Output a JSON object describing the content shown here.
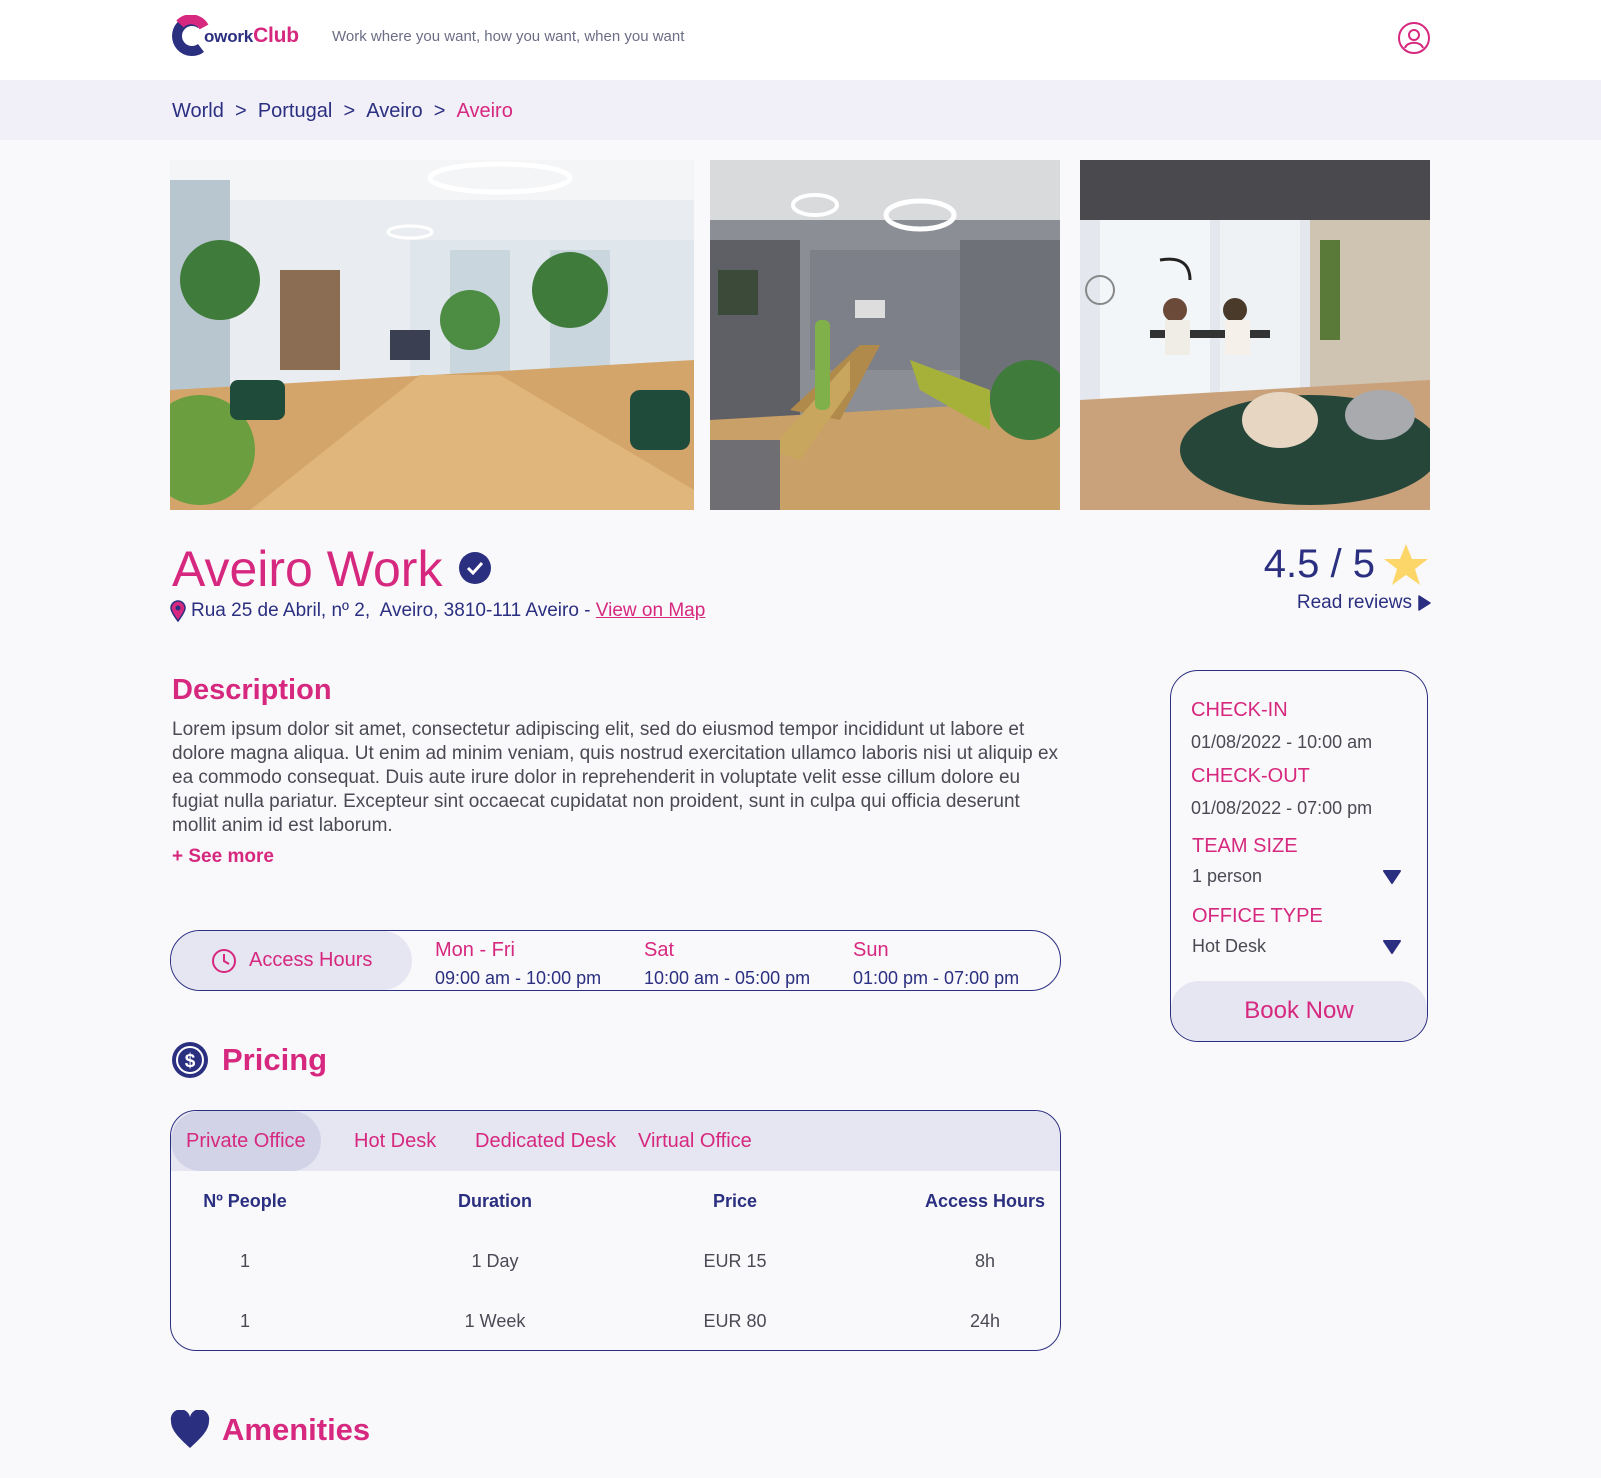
{
  "header": {
    "logo_part1": "owork",
    "logo_part2": "Club",
    "tagline": "Work where you want, how you want, when you want"
  },
  "breadcrumb": [
    "World",
    "Portugal",
    "Aveiro",
    "Aveiro"
  ],
  "breadcrumb_separator": ">",
  "listing": {
    "title": "Aveiro Work",
    "address": "Rua 25 de Abril, nº 2,  Aveiro, 3810-111 Aveiro - ",
    "map_link": "View on Map",
    "rating": "4.5 / 5",
    "reviews_link": "Read reviews"
  },
  "description": {
    "heading": "Description",
    "body": "Lorem ipsum dolor sit amet, consectetur adipiscing elit, sed do eiusmod tempor incididunt ut labore et dolore magna aliqua. Ut enim ad minim veniam, quis nostrud exercitation ullamco laboris nisi ut aliquip ex ea commodo consequat. Duis aute irure dolor in reprehenderit in voluptate velit esse cillum dolore eu fugiat nulla pariatur. Excepteur sint occaecat cupidatat non proident, sunt in culpa qui officia deserunt mollit anim id est laborum.",
    "see_more": "+ See more"
  },
  "access_hours": {
    "label": "Access Hours",
    "days": [
      {
        "day": "Mon - Fri",
        "time": "09:00 am - 10:00 pm"
      },
      {
        "day": "Sat",
        "time": "10:00 am - 05:00 pm"
      },
      {
        "day": "Sun",
        "time": "01:00 pm - 07:00 pm"
      }
    ]
  },
  "booking": {
    "checkin_label": "CHECK-IN",
    "checkin_value": "01/08/2022 - 10:00 am",
    "checkout_label": "CHECK-OUT",
    "checkout_value": "01/08/2022 - 07:00 pm",
    "team_label": "TEAM SIZE",
    "team_value": "1 person",
    "office_label": "OFFICE TYPE",
    "office_value": "Hot Desk",
    "book_button": "Book Now"
  },
  "pricing": {
    "heading": "Pricing",
    "tabs": [
      "Private Office",
      "Hot Desk",
      "Dedicated Desk",
      "Virtual Office"
    ],
    "active_tab": "Private Office",
    "columns": [
      "Nº People",
      "Duration",
      "Price",
      "Access Hours"
    ],
    "rows": [
      [
        "1",
        "1 Day",
        "EUR 15",
        "8h"
      ],
      [
        "1",
        "1 Week",
        "EUR 80",
        "24h"
      ]
    ]
  },
  "amenities": {
    "heading": "Amenities"
  },
  "colors": {
    "primary": "#2b2f80",
    "accent": "#d6287f",
    "star": "#fcd669",
    "soft": "#e6e5f2"
  }
}
